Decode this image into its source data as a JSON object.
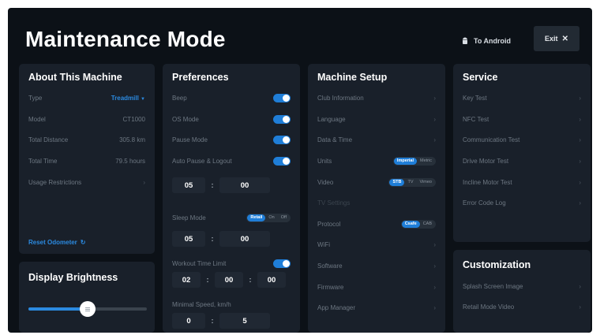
{
  "header": {
    "title": "Maintenance Mode",
    "to_android": "To Android",
    "exit": "Exit",
    "exit_icon": "close-icon"
  },
  "about": {
    "title": "About This Machine",
    "type_label": "Type",
    "type_value": "Treadmill",
    "model_label": "Model",
    "model_value": "CT1000",
    "distance_label": "Total Distance",
    "distance_value": "305.8 km",
    "time_label": "Total Time",
    "time_value": "79.5 hours",
    "usage_label": "Usage Restrictions",
    "reset_label": "Reset Odometer"
  },
  "brightness": {
    "title": "Display Brightness",
    "level": 0.5
  },
  "preferences": {
    "title": "Preferences",
    "beep": "Beep",
    "os_mode": "OS Mode",
    "pause_mode": "Pause Mode",
    "auto_pause": "Auto Pause & Logout",
    "auto_pause_min": "05",
    "auto_pause_sec": "00",
    "sleep_mode": "Sleep Mode",
    "sleep_options": [
      "Retail",
      "On",
      "Off"
    ],
    "sleep_min": "05",
    "sleep_sec": "00",
    "workout_limit": "Workout Time Limit",
    "workout_h": "02",
    "workout_m": "00",
    "workout_s": "00",
    "minimal_speed": "Minimal Speed, km/h",
    "speed_int": "0",
    "speed_dec": "5"
  },
  "setup": {
    "title": "Machine Setup",
    "club_info": "Club Information",
    "language": "Language",
    "date_time": "Data & Time",
    "units": "Units",
    "units_options": [
      "Imperial",
      "Metric"
    ],
    "video": "Video",
    "video_options": [
      "STB",
      "TV",
      "Vimeo"
    ],
    "tv_settings": "TV Settings",
    "protocol": "Protocol",
    "protocol_options": [
      "Csafe",
      "CAB"
    ],
    "wifi": "WiFi",
    "software": "Software",
    "firmware": "Firmware",
    "app_manager": "App Manager"
  },
  "service": {
    "title": "Service",
    "items": [
      "Key Test",
      "NFC Test",
      "Communication Test",
      "Drive Motor Test",
      "Incline Motor Test",
      "Error Code Log"
    ]
  },
  "customization": {
    "title": "Customization",
    "items": [
      "Splash Screen Image",
      "Retail Mode Video"
    ]
  },
  "colors": {
    "accent": "#1f7ed8",
    "background": "#0c1117",
    "card": "#19202a"
  }
}
